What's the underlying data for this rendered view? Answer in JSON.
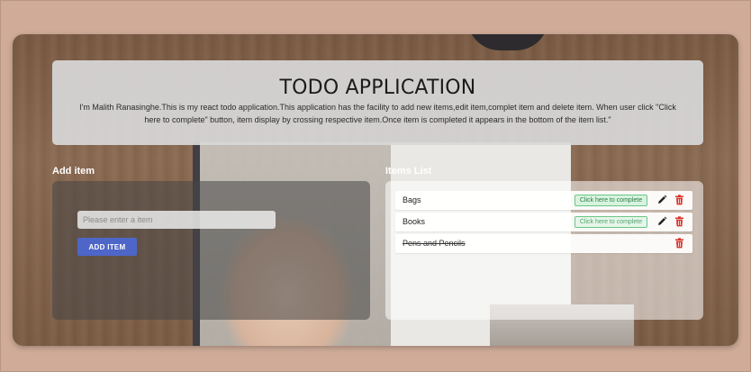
{
  "header": {
    "title": "TODO APPLICATION",
    "description": "I'm Malith Ranasinghe.This is my react todo application.This application has the facility to add new items,edit item,complet item and delete item. When user click \"Click here to complete\" button, item display by crossing respective item.Once item is completed it appears in the bottom of the item list.\""
  },
  "add_section": {
    "label": "Add item",
    "input_placeholder": "Please enter a item",
    "input_value": "",
    "button_label": "ADD ITEM"
  },
  "list_section": {
    "label": "Items List",
    "items": [
      {
        "name": "Bags",
        "completed": false,
        "complete_label": "Click here to complete"
      },
      {
        "name": "Books",
        "completed": false,
        "complete_label": "Click here to complete"
      },
      {
        "name": "Pens and Pencils",
        "completed": true,
        "complete_label": ""
      }
    ]
  },
  "colors": {
    "page_background": "#cfab98",
    "add_button": "#4e66c8",
    "complete_button_bg": "#d7f3df",
    "complete_button_border": "#6cc685",
    "delete_icon": "#d9342b",
    "edit_icon": "#222222"
  },
  "icons": {
    "edit": "pencil-icon",
    "delete": "trash-icon"
  }
}
